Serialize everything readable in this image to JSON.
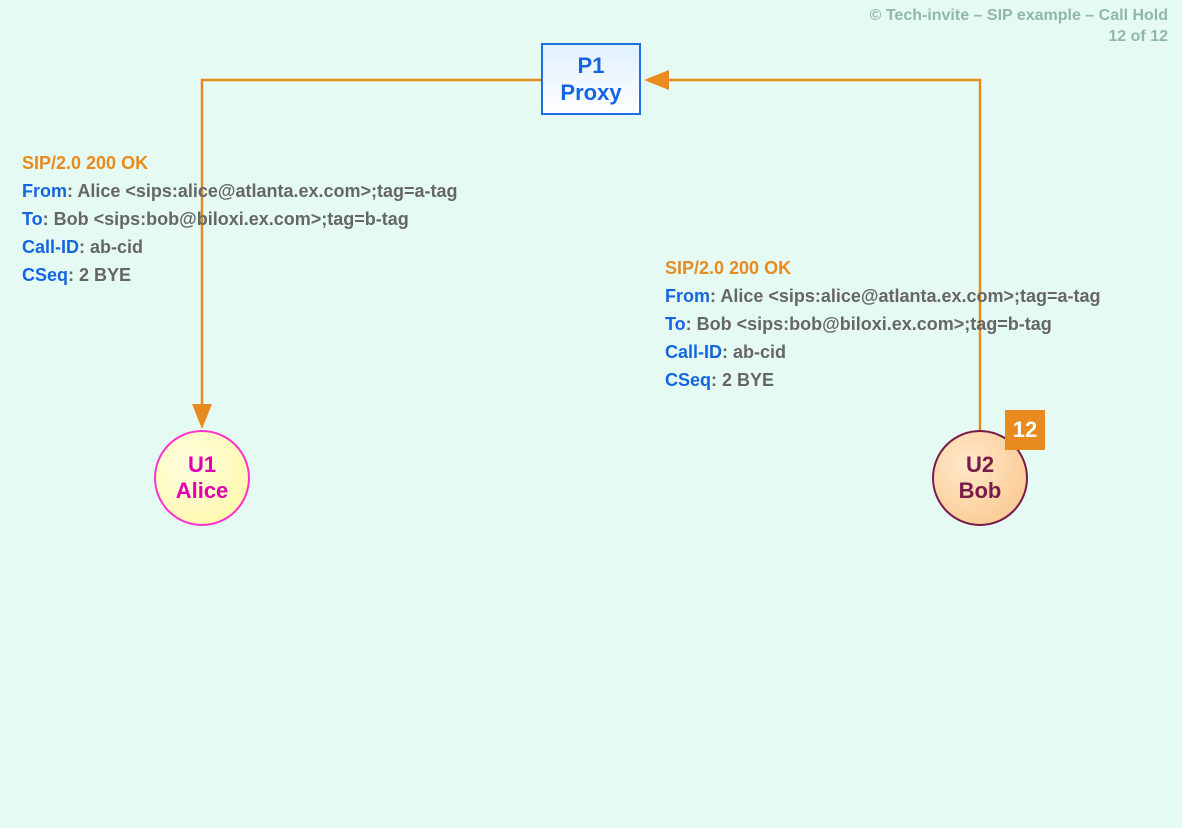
{
  "header": {
    "copyright": "© Tech-invite – SIP example – Call Hold",
    "page_counter": "12 of 12"
  },
  "proxy": {
    "line1": "P1",
    "line2": "Proxy"
  },
  "node_u1": {
    "line1": "U1",
    "line2": "Alice"
  },
  "node_u2": {
    "line1": "U2",
    "line2": "Bob"
  },
  "step_badge": "12",
  "msg_left": {
    "status": "SIP/2.0 200 OK",
    "from_label": "From",
    "from_value": ": Alice <sips:alice@atlanta.ex.com>;tag=a-tag",
    "to_label": "To",
    "to_value": ": Bob <sips:bob@biloxi.ex.com>;tag=b-tag",
    "callid_label": "Call-ID",
    "callid_value": ": ab-cid",
    "cseq_label": "CSeq",
    "cseq_value": ": 2 BYE"
  },
  "msg_right": {
    "status": "SIP/2.0 200 OK",
    "from_label": "From",
    "from_value": ": Alice <sips:alice@atlanta.ex.com>;tag=a-tag",
    "to_label": "To",
    "to_value": ": Bob <sips:bob@biloxi.ex.com>;tag=b-tag",
    "callid_label": "Call-ID",
    "callid_value": ": ab-cid",
    "cseq_label": "CSeq",
    "cseq_value": ": 2 BYE"
  }
}
